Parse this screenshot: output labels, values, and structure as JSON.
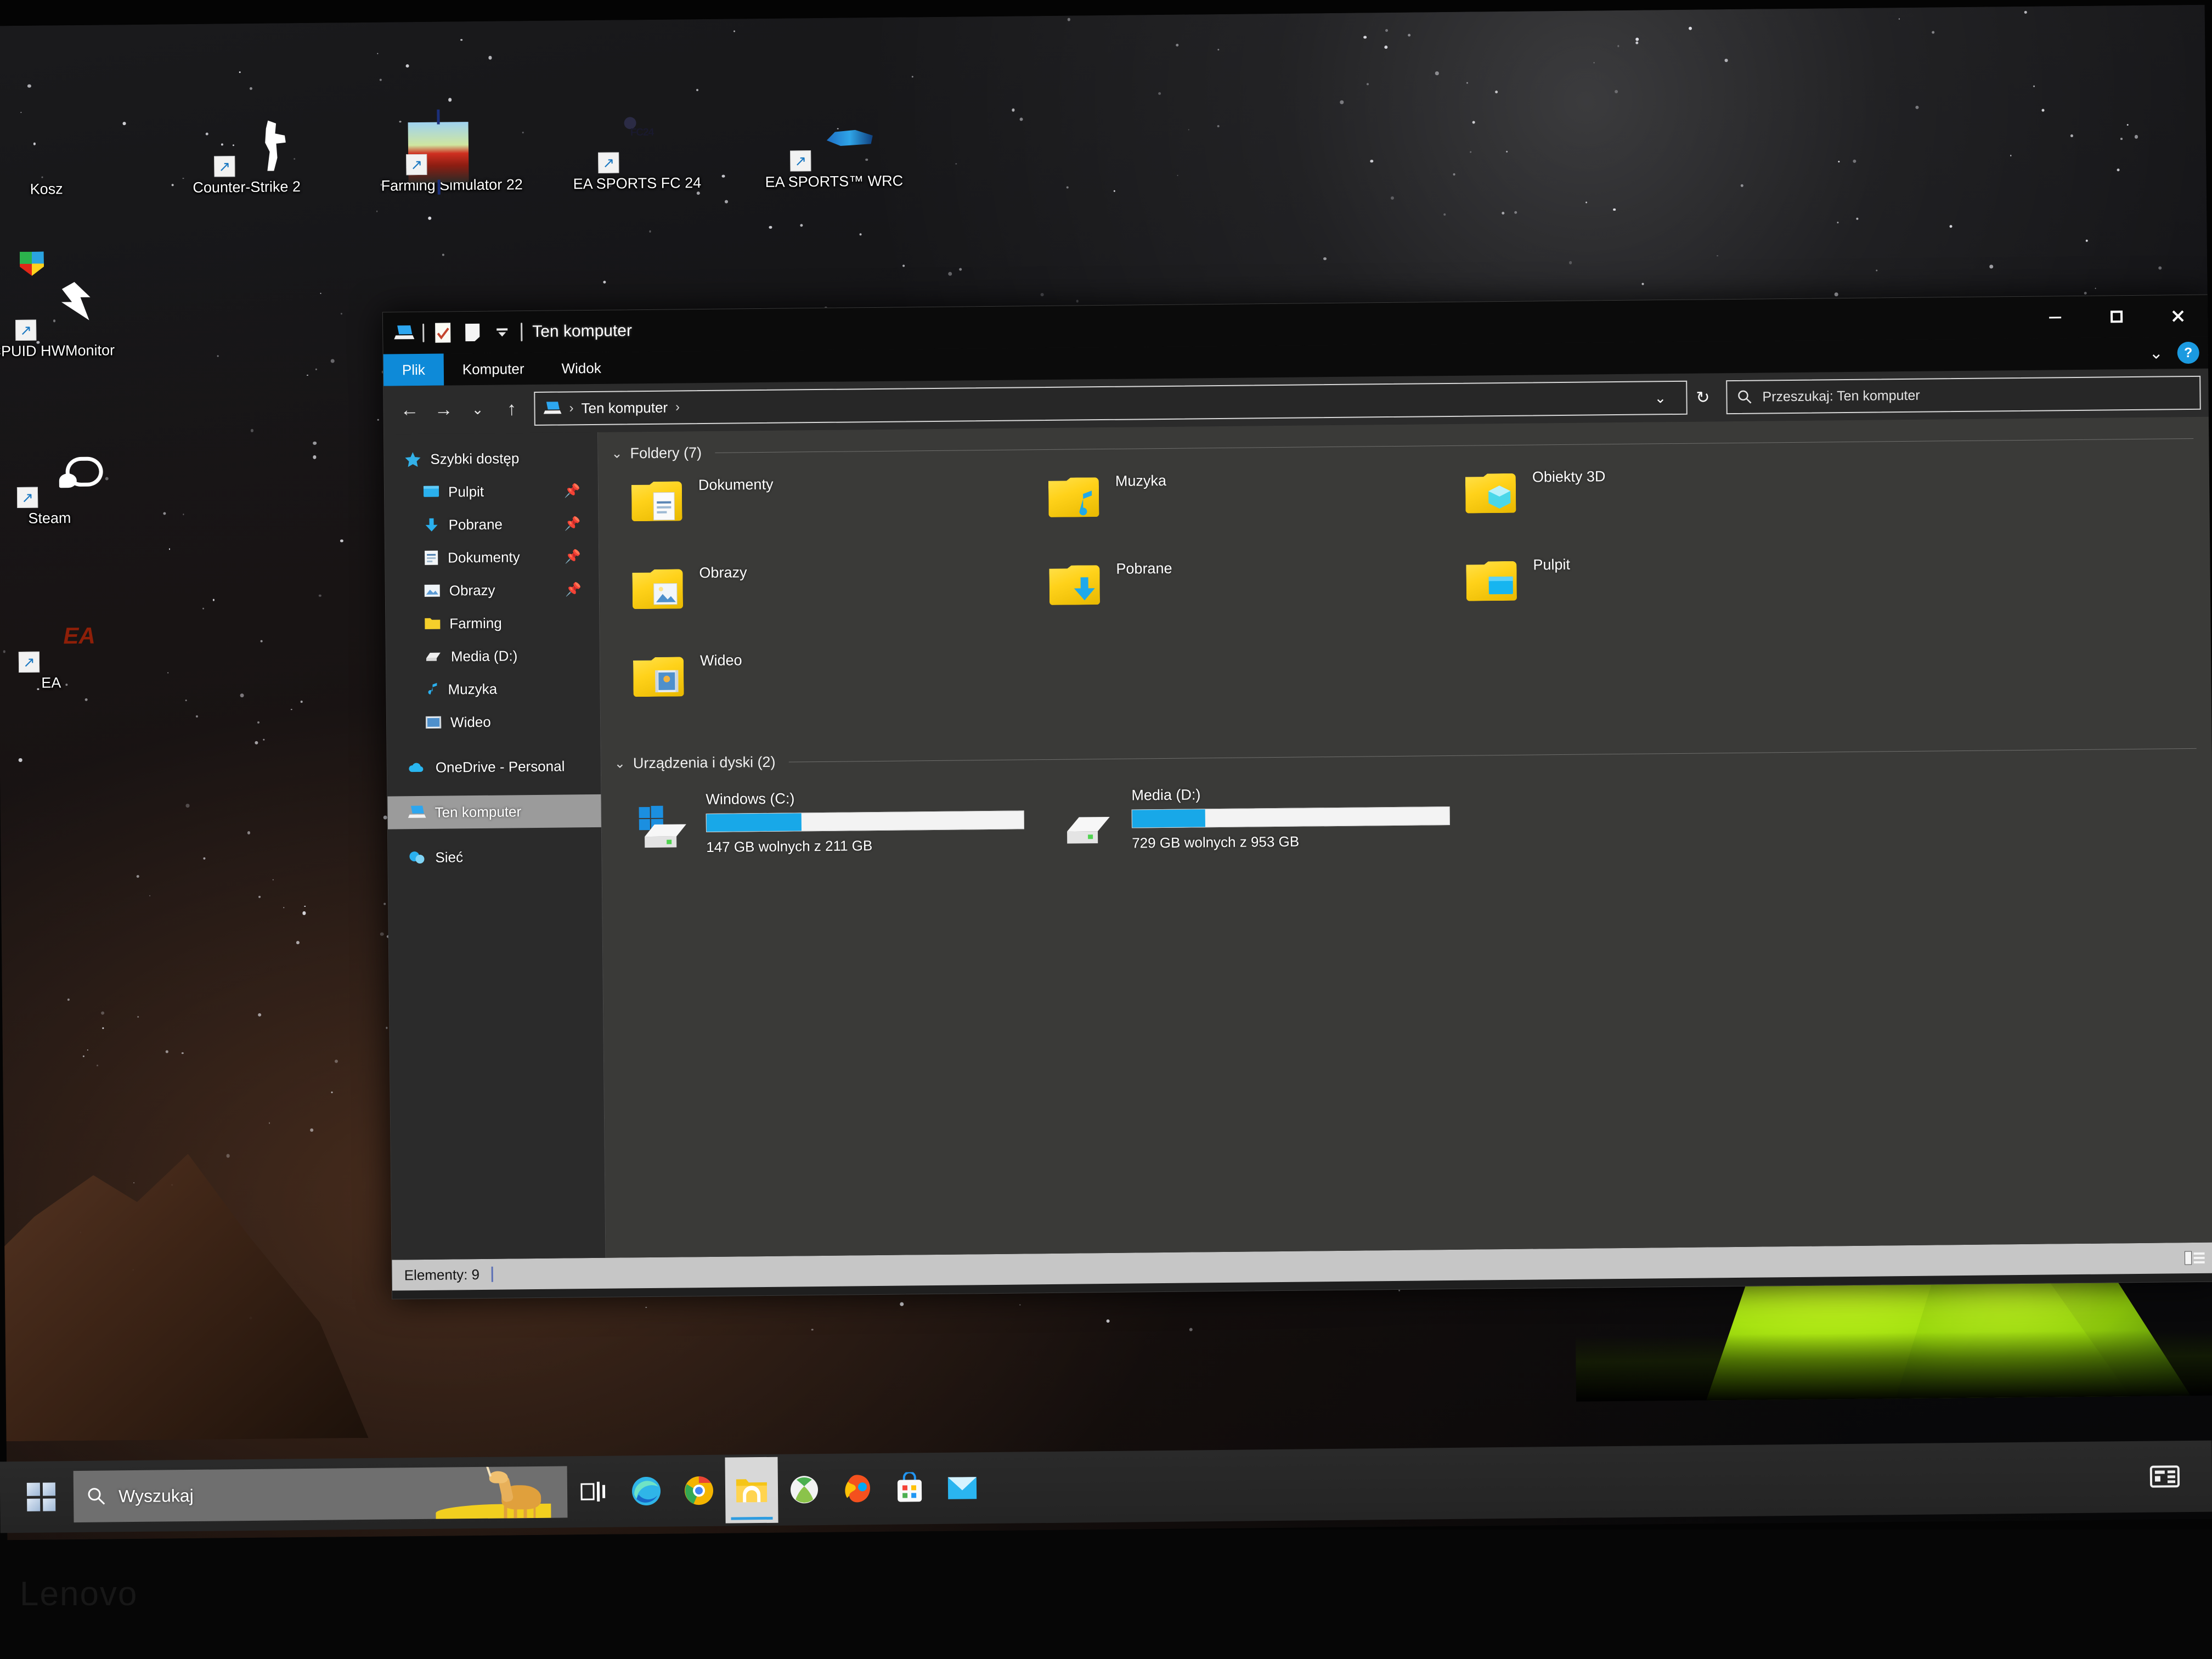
{
  "desktop": {
    "icons": [
      {
        "label": "Kosz",
        "icon": "recycle-bin-icon",
        "shortcut": false
      },
      {
        "label": "Counter-Strike 2",
        "icon": "counter-strike-2-icon",
        "shortcut": true
      },
      {
        "label": "Farming Simulator 22",
        "icon": "farming-simulator-22-icon",
        "shortcut": true
      },
      {
        "label": "EA SPORTS FC 24",
        "icon": "ea-sports-fc-24-icon",
        "shortcut": true
      },
      {
        "label": "EA SPORTS™ WRC",
        "icon": "ea-sports-wrc-icon",
        "shortcut": true
      },
      {
        "label": "CPUID HWMonitor",
        "icon": "cpuid-hwmonitor-icon",
        "shortcut": true
      },
      {
        "label": "Steam",
        "icon": "steam-icon",
        "shortcut": true
      },
      {
        "label": "EA",
        "icon": "ea-app-icon",
        "shortcut": true
      }
    ]
  },
  "window": {
    "title": "Ten komputer",
    "quick_access_icons": [
      "this-pc-icon",
      "properties-icon",
      "new-folder-icon",
      "customize-chevron-icon"
    ],
    "controls": {
      "minimize": "–",
      "maximize": "❐",
      "close": "✕",
      "ribbon_chevron": "⌄",
      "help": "?"
    },
    "ribbon_tabs": [
      {
        "label": "Plik",
        "active": true
      },
      {
        "label": "Komputer",
        "active": false
      },
      {
        "label": "Widok",
        "active": false
      }
    ],
    "nav": {
      "back": "←",
      "forward": "→",
      "recent": "⌄",
      "up": "↑",
      "breadcrumb_icon": "this-pc-icon",
      "breadcrumb": "Ten komputer",
      "crumb_separator": "›",
      "dropdown": "⌄",
      "refresh": "↻"
    },
    "search": {
      "placeholder": "Przeszukaj: Ten komputer",
      "icon": "search-icon"
    },
    "status": {
      "items_label": "Elementy: 9",
      "view_icon": "details-view-icon"
    }
  },
  "navpane": {
    "items": [
      {
        "label": "Szybki dostęp",
        "icon": "quick-access-star-icon",
        "sub": false,
        "pinned": false,
        "selected": false
      },
      {
        "label": "Pulpit",
        "icon": "desktop-icon",
        "sub": true,
        "pinned": true,
        "selected": false
      },
      {
        "label": "Pobrane",
        "icon": "downloads-icon",
        "sub": true,
        "pinned": true,
        "selected": false
      },
      {
        "label": "Dokumenty",
        "icon": "documents-icon",
        "sub": true,
        "pinned": true,
        "selected": false
      },
      {
        "label": "Obrazy",
        "icon": "pictures-icon",
        "sub": true,
        "pinned": true,
        "selected": false
      },
      {
        "label": "Farming",
        "icon": "folder-icon",
        "sub": true,
        "pinned": false,
        "selected": false
      },
      {
        "label": "Media (D:)",
        "icon": "drive-icon",
        "sub": true,
        "pinned": false,
        "selected": false
      },
      {
        "label": "Muzyka",
        "icon": "music-icon",
        "sub": true,
        "pinned": false,
        "selected": false
      },
      {
        "label": "Wideo",
        "icon": "videos-icon",
        "sub": true,
        "pinned": false,
        "selected": false
      }
    ],
    "onedrive": {
      "label": "OneDrive - Personal",
      "icon": "onedrive-icon"
    },
    "thispc": {
      "label": "Ten komputer",
      "icon": "this-pc-icon",
      "selected": true
    },
    "network": {
      "label": "Sieć",
      "icon": "network-icon"
    }
  },
  "content": {
    "groups": [
      {
        "title": "Foldery (7)",
        "chevron": "⌄",
        "items": [
          {
            "label": "Dokumenty",
            "icon": "documents-folder-icon"
          },
          {
            "label": "Muzyka",
            "icon": "music-folder-icon"
          },
          {
            "label": "Obiekty 3D",
            "icon": "3d-objects-folder-icon"
          },
          {
            "label": "Obrazy",
            "icon": "pictures-folder-icon"
          },
          {
            "label": "Pobrane",
            "icon": "downloads-folder-icon"
          },
          {
            "label": "Pulpit",
            "icon": "desktop-folder-icon"
          },
          {
            "label": "Wideo",
            "icon": "videos-folder-icon"
          }
        ]
      },
      {
        "title": "Urządzenia i dyski (2)",
        "chevron": "⌄",
        "drives": [
          {
            "name": "Windows (C:)",
            "free_text": "147 GB wolnych z 211 GB",
            "free_gb": 147,
            "total_gb": 211,
            "used_percent": 30,
            "icon": "windows-drive-icon"
          },
          {
            "name": "Media (D:)",
            "free_text": "729 GB wolnych z 953 GB",
            "free_gb": 729,
            "total_gb": 953,
            "used_percent": 23,
            "icon": "hard-drive-icon"
          }
        ]
      }
    ]
  },
  "taskbar": {
    "start": "start-button",
    "search_placeholder": "Wyszukaj",
    "search_icon": "search-icon",
    "task_view": "task-view-icon",
    "apps": [
      {
        "name": "microsoft-edge-icon",
        "active": false
      },
      {
        "name": "google-chrome-icon",
        "active": false
      },
      {
        "name": "file-explorer-icon",
        "active": true
      },
      {
        "name": "xbox-icon",
        "active": false
      },
      {
        "name": "paint-3d-icon",
        "active": false
      },
      {
        "name": "microsoft-store-icon",
        "active": false
      },
      {
        "name": "mail-icon",
        "active": false
      }
    ],
    "tray": [
      {
        "name": "news-and-interests-icon"
      }
    ]
  },
  "bezel": {
    "brand": "Lenovo"
  },
  "colors": {
    "accent": "#0e8ad8",
    "drive_bar": "#18a8e8",
    "window_bg": "#3a3a38",
    "navpane_bg": "#2b2b2b",
    "titlebar_bg": "#0b0b0b",
    "statusbar_bg": "#c6c6c6",
    "folder_yellow": "#ffd21a"
  }
}
